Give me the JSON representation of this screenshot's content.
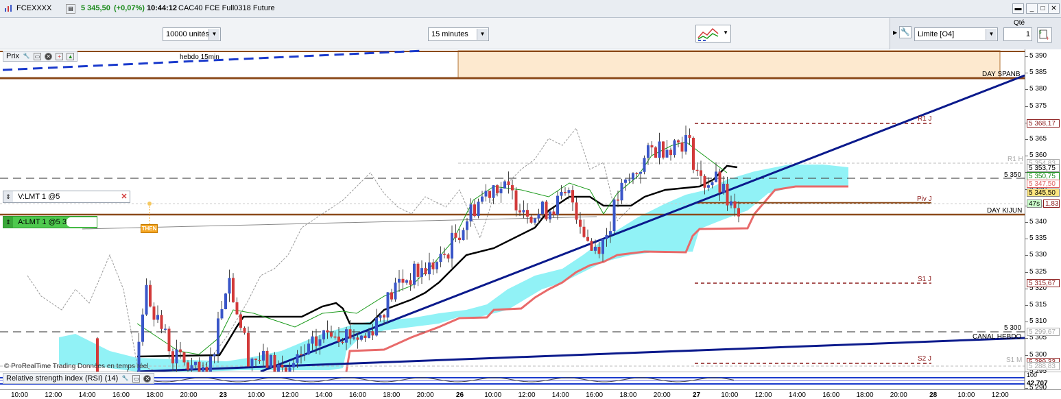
{
  "titlebar": {
    "symbol": "FCEXXXX",
    "price": "5 345,50",
    "change": "(+0,07%)",
    "time": "10:44:12",
    "instrument": "CAC40 FCE Full0318 Future"
  },
  "toolbar": {
    "quantity_select": "10000 unités",
    "timeframe_select": "15 minutes",
    "order_type_select": "Limite [O4]",
    "qty_label": "Qté",
    "qty_value": "1"
  },
  "panel": {
    "title": "Prix",
    "hebdo_label": "hebdo 15min",
    "copyright": "© ProRealTime Trading  Données en temps réel"
  },
  "orders": [
    {
      "label": "V:LMT 1 @5",
      "side": "sell"
    },
    {
      "label": "A:LMT 1 @5 3",
      "side": "buy"
    }
  ],
  "then_badge": "THEN",
  "levels": {
    "day_spanb": "DAY SPANB",
    "r1j": "R1 J",
    "r1h": "R1 H",
    "l5350": "5 350",
    "pivj": "Piv J",
    "day_kijun": "DAY KIJUN",
    "s1j": "S1 J",
    "l5300": "5 300",
    "canal_hebdo": "CANAL HEBDO",
    "s2j": "S2 J",
    "s1m": "S1 M"
  },
  "price_axis": {
    "ticks": [
      "5 390",
      "5 385",
      "5 380",
      "5 375",
      "5 370",
      "5 365",
      "5 360",
      "5 355",
      "5 350",
      "5 345",
      "5 340",
      "5 335",
      "5 330",
      "5 325",
      "5 320",
      "5 315",
      "5 310",
      "5 305",
      "5 300",
      "5 295",
      "5 290"
    ],
    "tags": [
      {
        "text": "5 368,17",
        "color": "#8b1a1a",
        "bg": "#fff"
      },
      {
        "text": "5 354,83",
        "color": "#aaaaaa",
        "bg": "#fff"
      },
      {
        "text": "5 353,75",
        "color": "#000",
        "bg": "#fff"
      },
      {
        "text": "5 350,75",
        "color": "#1a8a1a",
        "bg": "#fff"
      },
      {
        "text": "5 347,50",
        "color": "#e06060",
        "bg": "#fff"
      },
      {
        "text": "5 345,50",
        "color": "#000",
        "bg": "#ffe680"
      },
      {
        "text": "47s",
        "color": "#000",
        "bg": "#ccffcc"
      },
      {
        "text": "1,83",
        "color": "#8b1a1a",
        "bg": "#fff"
      },
      {
        "text": "5 315,67",
        "color": "#8b1a1a",
        "bg": "#fff"
      },
      {
        "text": "5 299,67",
        "color": "#aaaaaa",
        "bg": "#fff"
      },
      {
        "text": "5 289,33",
        "color": "#8b1a1a",
        "bg": "#fff"
      },
      {
        "text": "5 288,83",
        "color": "#aaaaaa",
        "bg": "#fff"
      }
    ]
  },
  "rsi": {
    "title": "Relative strength index (RSI) (14)",
    "value": "42,707",
    "top_tick": "100"
  },
  "time_axis": [
    "10:00",
    "12:00",
    "14:00",
    "16:00",
    "18:00",
    "20:00",
    "23",
    "10:00",
    "12:00",
    "14:00",
    "16:00",
    "18:00",
    "20:00",
    "26",
    "10:00",
    "12:00",
    "14:00",
    "16:00",
    "18:00",
    "20:00",
    "27",
    "10:00",
    "12:00",
    "14:00",
    "16:00",
    "18:00",
    "20:00",
    "28",
    "10:00",
    "12:00"
  ],
  "colors": {
    "up_candle": "#3a56c8",
    "down_candle": "#d23a3a",
    "cloud": "#7ef0f5",
    "kijun": "#000000",
    "tenkan": "#1a9a1a",
    "span_line": "#e86a6a",
    "trend": "#0b1a8c",
    "level_brown": "#8b4a1a",
    "change_green": "#1a8a1a"
  }
}
